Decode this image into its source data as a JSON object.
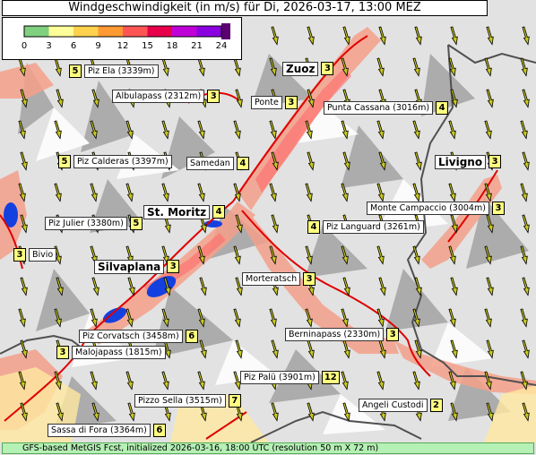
{
  "title": "Windgeschwindigkeit (in m/s) für Di, 2026-03-17, 13:00 MEZ",
  "legend": {
    "ticks": [
      "0",
      "3",
      "6",
      "9",
      "12",
      "15",
      "18",
      "21",
      "24"
    ],
    "colors": [
      "#7fd07f",
      "#ffff99",
      "#ffd24d",
      "#ff9933",
      "#ff5555",
      "#e8004a",
      "#c000d8",
      "#8a00e0"
    ]
  },
  "footer": "GFS-based MetGIS Fcst, initialized 2026-03-16, 18:00 UTC  (resolution 50 m X 72 m)",
  "places": [
    {
      "name": "Piz Ela (3339m)",
      "value": "5",
      "order": "valfirst",
      "size": "small"
    },
    {
      "name": "Zuoz",
      "value": "3",
      "order": "namefirst",
      "size": "big"
    },
    {
      "name": "Albulapass (2312m)",
      "value": "3",
      "order": "namefirst",
      "size": "small"
    },
    {
      "name": "Ponte",
      "value": "3",
      "order": "namefirst",
      "size": "small"
    },
    {
      "name": "Punta Cassana (3016m)",
      "value": "4",
      "order": "namefirst",
      "size": "small"
    },
    {
      "name": "Piz Calderas (3397m)",
      "value": "5",
      "order": "valfirst",
      "size": "small"
    },
    {
      "name": "Samedan",
      "value": "4",
      "order": "namefirst",
      "size": "small"
    },
    {
      "name": "Livigno",
      "value": "3",
      "order": "namefirst",
      "size": "big"
    },
    {
      "name": "St. Moritz",
      "value": "4",
      "order": "namefirst",
      "size": "big"
    },
    {
      "name": "Monte Campaccio (3004m)",
      "value": "3",
      "order": "namefirst",
      "size": "small"
    },
    {
      "name": "Piz Julier (3380m)",
      "value": "5",
      "order": "namefirst",
      "size": "small"
    },
    {
      "name": "Piz Languard (3261m)",
      "value": "4",
      "order": "valfirst",
      "size": "small"
    },
    {
      "name": "Bivio",
      "value": "3",
      "order": "valfirst",
      "size": "small"
    },
    {
      "name": "Silvaplana",
      "value": "3",
      "order": "namefirst",
      "size": "big"
    },
    {
      "name": "Morteratsch",
      "value": "3",
      "order": "namefirst",
      "size": "small"
    },
    {
      "name": "Piz Corvatsch (3458m)",
      "value": "6",
      "order": "namefirst",
      "size": "small"
    },
    {
      "name": "Berninapass (2330m)",
      "value": "3",
      "order": "namefirst",
      "size": "small"
    },
    {
      "name": "Malojapass (1815m)",
      "value": "3",
      "order": "valfirst",
      "size": "small"
    },
    {
      "name": "Piz Palü (3901m)",
      "value": "12",
      "order": "namefirst",
      "size": "small"
    },
    {
      "name": "Pizzo Sella (3515m)",
      "value": "7",
      "order": "namefirst",
      "size": "small"
    },
    {
      "name": "Angeli Custodi",
      "value": "2",
      "order": "namefirst",
      "size": "small"
    },
    {
      "name": "Sassa di Fora (3364m)",
      "value": "6",
      "order": "namefirst",
      "size": "small"
    }
  ]
}
